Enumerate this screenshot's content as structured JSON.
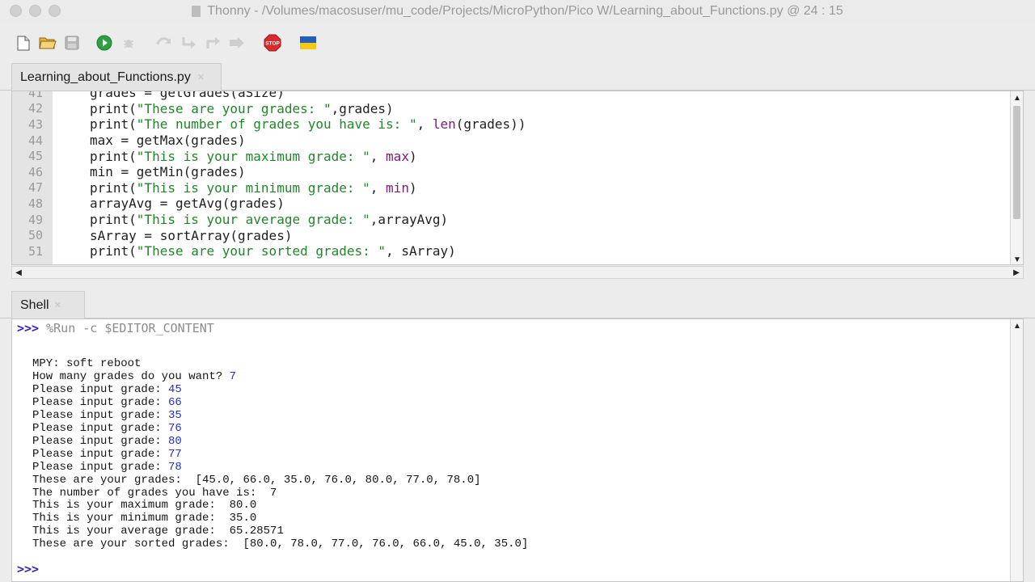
{
  "window": {
    "title": "Thonny  -  /Volumes/macosuser/mu_code/Projects/MicroPython/Pico W/Learning_about_Functions.py  @  24 : 15"
  },
  "toolbar": {
    "buttons": [
      "new-file-icon",
      "open-file-icon",
      "save-icon",
      "run-icon",
      "debug-icon",
      "step-over-icon",
      "step-into-icon",
      "step-out-icon",
      "resume-icon",
      "stop-icon",
      "ukraine-flag-icon"
    ],
    "stop_label": "STOP"
  },
  "editor": {
    "tab_label": "Learning_about_Functions.py",
    "lines": [
      {
        "n": "41",
        "parts": [
          {
            "t": "grades = getGrades(aSize)",
            "c": ""
          }
        ]
      },
      {
        "n": "42",
        "parts": [
          {
            "t": "print(",
            "c": ""
          },
          {
            "t": "\"These are your grades: \"",
            "c": "str"
          },
          {
            "t": ",grades)",
            "c": ""
          }
        ]
      },
      {
        "n": "43",
        "parts": [
          {
            "t": "print(",
            "c": ""
          },
          {
            "t": "\"The number of grades you have is: \"",
            "c": "str"
          },
          {
            "t": ", ",
            "c": ""
          },
          {
            "t": "len",
            "c": "fn"
          },
          {
            "t": "(grades))",
            "c": ""
          }
        ]
      },
      {
        "n": "44",
        "parts": [
          {
            "t": "max = getMax(grades)",
            "c": ""
          }
        ]
      },
      {
        "n": "45",
        "parts": [
          {
            "t": "print(",
            "c": ""
          },
          {
            "t": "\"This is your maximum grade: \"",
            "c": "str"
          },
          {
            "t": ", ",
            "c": ""
          },
          {
            "t": "max",
            "c": "fn"
          },
          {
            "t": ")",
            "c": ""
          }
        ]
      },
      {
        "n": "46",
        "parts": [
          {
            "t": "min = getMin(grades)",
            "c": ""
          }
        ]
      },
      {
        "n": "47",
        "parts": [
          {
            "t": "print(",
            "c": ""
          },
          {
            "t": "\"This is your minimum grade: \"",
            "c": "str"
          },
          {
            "t": ", ",
            "c": ""
          },
          {
            "t": "min",
            "c": "fn"
          },
          {
            "t": ")",
            "c": ""
          }
        ]
      },
      {
        "n": "48",
        "parts": [
          {
            "t": "arrayAvg = getAvg(grades)",
            "c": ""
          }
        ]
      },
      {
        "n": "49",
        "parts": [
          {
            "t": "print(",
            "c": ""
          },
          {
            "t": "\"This is your average grade: \"",
            "c": "str"
          },
          {
            "t": ",arrayAvg)",
            "c": ""
          }
        ]
      },
      {
        "n": "50",
        "parts": [
          {
            "t": "sArray = sortArray(grades)",
            "c": ""
          }
        ]
      },
      {
        "n": "51",
        "parts": [
          {
            "t": "print(",
            "c": ""
          },
          {
            "t": "\"These are your sorted grades: \"",
            "c": "str"
          },
          {
            "t": ", sArray)",
            "c": ""
          }
        ]
      }
    ]
  },
  "shell": {
    "tab_label": "Shell",
    "prompt": ">>>",
    "command": "%Run -c $EDITOR_CONTENT",
    "output": [
      {
        "text": "MPY: soft reboot",
        "input": ""
      },
      {
        "text": "How many grades do you want? ",
        "input": "7"
      },
      {
        "text": "Please input grade: ",
        "input": "45"
      },
      {
        "text": "Please input grade: ",
        "input": "66"
      },
      {
        "text": "Please input grade: ",
        "input": "35"
      },
      {
        "text": "Please input grade: ",
        "input": "76"
      },
      {
        "text": "Please input grade: ",
        "input": "80"
      },
      {
        "text": "Please input grade: ",
        "input": "77"
      },
      {
        "text": "Please input grade: ",
        "input": "78"
      },
      {
        "text": "These are your grades:  [45.0, 66.0, 35.0, 76.0, 80.0, 77.0, 78.0]",
        "input": ""
      },
      {
        "text": "The number of grades you have is:  7",
        "input": ""
      },
      {
        "text": "This is your maximum grade:  80.0",
        "input": ""
      },
      {
        "text": "This is your minimum grade:  35.0",
        "input": ""
      },
      {
        "text": "This is your average grade:  65.28571",
        "input": ""
      },
      {
        "text": "These are your sorted grades:  [80.0, 78.0, 77.0, 76.0, 66.0, 45.0, 35.0]",
        "input": ""
      }
    ],
    "final_prompt": ">>>"
  },
  "colors": {
    "string": "#21862a",
    "builtin": "#7a1a7a",
    "prompt": "#3c1dc4",
    "user_input": "#2631c2"
  }
}
